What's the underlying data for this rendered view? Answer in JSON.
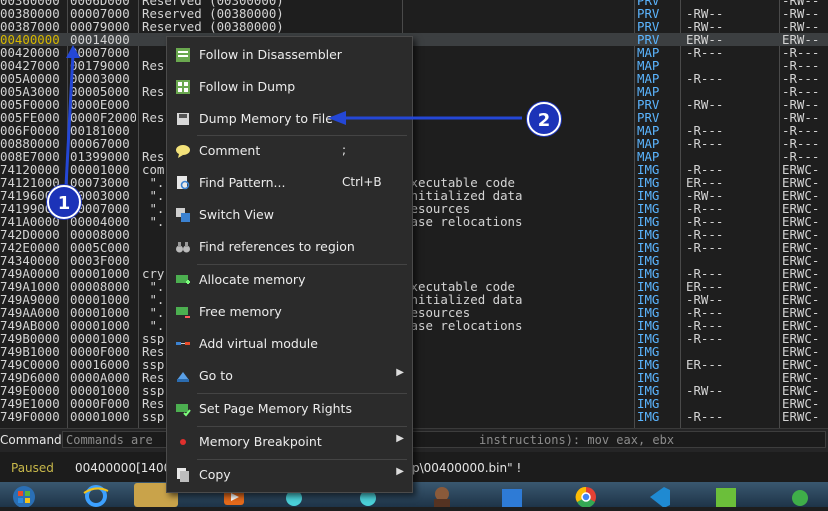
{
  "memory_rows": [
    {
      "addr": "00360000",
      "size": "0006D000",
      "info": "Reserved (00300000)",
      "type": "PRV",
      "prot": "",
      "init": "-RW--"
    },
    {
      "addr": "00380000",
      "size": "00007000",
      "info": "Reserved (00380000)",
      "type": "PRV",
      "prot": "-RW--",
      "init": "-RW--"
    },
    {
      "addr": "00387000",
      "size": "00079000",
      "info": "Reserved (00380000)",
      "type": "PRV",
      "prot": "-RW--",
      "init": "-RW--"
    },
    {
      "addr": "00400000",
      "size": "00014000",
      "info": "",
      "type": "PRV",
      "prot": "ERW--",
      "init": "ERW--"
    },
    {
      "addr": "00420000",
      "size": "00007000",
      "info": "",
      "type": "MAP",
      "prot": "-R---",
      "init": "-R---"
    },
    {
      "addr": "00427000",
      "size": "00179000",
      "info": "Res",
      "type": "MAP",
      "prot": "",
      "init": "-R---"
    },
    {
      "addr": "005A0000",
      "size": "00003000",
      "info": "",
      "type": "MAP",
      "prot": "-R---",
      "init": "-R---"
    },
    {
      "addr": "005A3000",
      "size": "00005000",
      "info": "Res",
      "type": "MAP",
      "prot": "",
      "init": "-R---"
    },
    {
      "addr": "005F0000",
      "size": "0000E000",
      "info": "",
      "type": "PRV",
      "prot": "-RW--",
      "init": "-RW--"
    },
    {
      "addr": "005FE000",
      "size": "0000F2000",
      "info": "Res",
      "type": "PRV",
      "prot": "",
      "init": "-RW--"
    },
    {
      "addr": "006F0000",
      "size": "00181000",
      "info": "",
      "type": "MAP",
      "prot": "-R---",
      "init": "-R---"
    },
    {
      "addr": "00880000",
      "size": "00067000",
      "info": "",
      "type": "MAP",
      "prot": "-R---",
      "init": "-R---"
    },
    {
      "addr": "008E7000",
      "size": "01399000",
      "info": "Res",
      "type": "MAP",
      "prot": "",
      "init": "-R---"
    },
    {
      "addr": "74120000",
      "size": "00001000",
      "info": "com",
      "type": "IMG",
      "prot": "-R---",
      "init": "ERWC-"
    },
    {
      "addr": "74121000",
      "size": "00073000",
      "info": " \".                                 xecutable code",
      "type": "IMG",
      "prot": "ER---",
      "init": "ERWC-"
    },
    {
      "addr": "74196000",
      "size": "00003000",
      "info": " \".                                 nitialized data",
      "type": "IMG",
      "prot": "-RW--",
      "init": "ERWC-"
    },
    {
      "addr": "74199000",
      "size": "00007000",
      "info": " \".                                 esources",
      "type": "IMG",
      "prot": "-R---",
      "init": "ERWC-"
    },
    {
      "addr": "741A0000",
      "size": "00004000",
      "info": " \".                                 ase relocations",
      "type": "IMG",
      "prot": "-R---",
      "init": "ERWC-"
    },
    {
      "addr": "742D0000",
      "size": "00008000",
      "info": "",
      "type": "IMG",
      "prot": "-R---",
      "init": "ERWC-"
    },
    {
      "addr": "742E0000",
      "size": "0005C000",
      "info": "",
      "type": "IMG",
      "prot": "-R---",
      "init": "ERWC-"
    },
    {
      "addr": "74340000",
      "size": "0003F000",
      "info": "",
      "type": "IMG",
      "prot": "",
      "init": "ERWC-"
    },
    {
      "addr": "749A0000",
      "size": "00001000",
      "info": "cry",
      "type": "IMG",
      "prot": "-R---",
      "init": "ERWC-"
    },
    {
      "addr": "749A1000",
      "size": "00008000",
      "info": " \".                                 xecutable code",
      "type": "IMG",
      "prot": "ER---",
      "init": "ERWC-"
    },
    {
      "addr": "749A9000",
      "size": "00001000",
      "info": " \".                                 nitialized data",
      "type": "IMG",
      "prot": "-RW--",
      "init": "ERWC-"
    },
    {
      "addr": "749AA000",
      "size": "00001000",
      "info": " \".                                 esources",
      "type": "IMG",
      "prot": "-R---",
      "init": "ERWC-"
    },
    {
      "addr": "749AB000",
      "size": "00001000",
      "info": " \".                                 ase relocations",
      "type": "IMG",
      "prot": "-R---",
      "init": "ERWC-"
    },
    {
      "addr": "749B0000",
      "size": "00001000",
      "info": "ssp",
      "type": "IMG",
      "prot": "-R---",
      "init": "ERWC-"
    },
    {
      "addr": "749B1000",
      "size": "0000F000",
      "info": "Res",
      "type": "IMG",
      "prot": "",
      "init": "ERWC-"
    },
    {
      "addr": "749C0000",
      "size": "00016000",
      "info": "ssp",
      "type": "IMG",
      "prot": "ER---",
      "init": "ERWC-"
    },
    {
      "addr": "749D6000",
      "size": "0000A000",
      "info": "Res",
      "type": "IMG",
      "prot": "",
      "init": "ERWC-"
    },
    {
      "addr": "749E0000",
      "size": "00001000",
      "info": "ssp",
      "type": "IMG",
      "prot": "-RW--",
      "init": "ERWC-"
    },
    {
      "addr": "749E1000",
      "size": "0000F000",
      "info": "Res",
      "type": "IMG",
      "prot": "",
      "init": "ERWC-"
    },
    {
      "addr": "749F0000",
      "size": "00001000",
      "info": "ssp",
      "type": "IMG",
      "prot": "-R---",
      "init": "ERWC-"
    }
  ],
  "context_menu": {
    "follow_disassembler": "Follow in Disassembler",
    "follow_dump": "Follow in Dump",
    "dump_memory": "Dump Memory to File",
    "comment": "Comment",
    "comment_shortcut": ";",
    "find_pattern": "Find Pattern...",
    "find_pattern_shortcut": "Ctrl+B",
    "switch_view": "Switch View",
    "find_references": "Find references to region",
    "allocate_memory": "Allocate memory",
    "free_memory": "Free memory",
    "add_virtual_module": "Add virtual module",
    "go_to": "Go to",
    "set_page_rights": "Set Page Memory Rights",
    "memory_breakpoint": "Memory Breakpoint",
    "copy": "Copy"
  },
  "command_bar": {
    "label": "Command:",
    "placeholder": "Commands are",
    "tail": "instructions): mov eax, ebx"
  },
  "status": {
    "state": "Paused",
    "message": "00400000[1400",
    "tail": "p\\00400000.bin\" !"
  },
  "annotations": {
    "badge1": "1",
    "badge2": "2"
  },
  "colors": {
    "background": "#1e1e1e",
    "type_text": "#5bb5ff",
    "selected_address": "#d6b800",
    "annotation_blue": "#1c33b8"
  }
}
